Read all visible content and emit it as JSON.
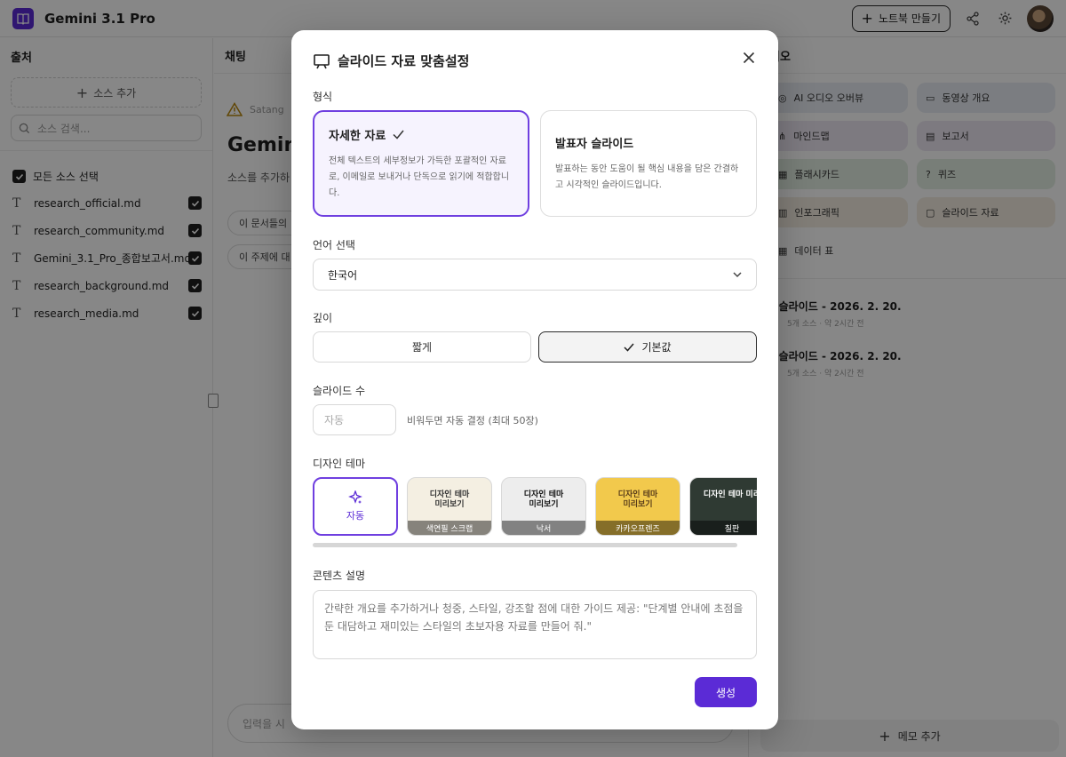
{
  "app": {
    "title": "Gemini 3.1 Pro"
  },
  "topbar": {
    "new_notebook_label": "노트북 만들기"
  },
  "sources": {
    "header": "출처",
    "add_label": "소스 추가",
    "search_placeholder": "소스 검색...",
    "select_all_label": "모든 소스 선택",
    "items": [
      {
        "name": "research_official.md"
      },
      {
        "name": "research_community.md"
      },
      {
        "name": "Gemini_3.1_Pro_종합보고서.md"
      },
      {
        "name": "research_background.md"
      },
      {
        "name": "research_media.md"
      }
    ]
  },
  "chat": {
    "header": "채팅",
    "warning_text": "Satang",
    "title": "Gemini",
    "subtitle": "소스를 추가하",
    "chips": [
      "이 문서들의",
      "이 주제에 대"
    ],
    "input_placeholder": "입력을 시"
  },
  "studio": {
    "header": "디오",
    "tiles": [
      {
        "label": "AI 오디오 오버뷰",
        "icon": "audio-icon",
        "color": "#e8ecf3"
      },
      {
        "label": "동영상 개요",
        "icon": "video-icon",
        "color": "#e8ecf3"
      },
      {
        "label": "마인드맵",
        "icon": "mindmap-icon",
        "color": "#ece6f2"
      },
      {
        "label": "보고서",
        "icon": "report-icon",
        "color": "#ece6f2"
      },
      {
        "label": "플래시카드",
        "icon": "flashcard-icon",
        "color": "#e3eee2"
      },
      {
        "label": "퀴즈",
        "icon": "quiz-icon",
        "color": "#e3eee2"
      },
      {
        "label": "인포그래픽",
        "icon": "infographic-icon",
        "color": "#f3ede0"
      },
      {
        "label": "슬라이드 자료",
        "icon": "slides-icon",
        "color": "#f3ede0"
      },
      {
        "label": "데이터 표",
        "icon": "table-icon",
        "color": "#ffffff"
      }
    ],
    "items": [
      {
        "title": "슬라이드 - 2026. 2. 20.",
        "meta": "5개 소스 · 약 2시간 전"
      },
      {
        "title": "슬라이드 - 2026. 2. 20.",
        "meta": "5개 소스 · 약 2시간 전"
      }
    ],
    "add_memo_label": "메모 추가"
  },
  "modal": {
    "title": "슬라이드 자료 맞춤설정",
    "format_label": "형식",
    "formats": [
      {
        "title": "자세한 자료",
        "desc": "전체 텍스트의 세부정보가 가득한 포괄적인 자료로, 이메일로 보내거나 단독으로 읽기에 적합합니다.",
        "selected": true
      },
      {
        "title": "발표자 슬라이드",
        "desc": "발표하는 동안 도움이 될 핵심 내용을 담은 간결하고 시각적인 슬라이드입니다.",
        "selected": false
      }
    ],
    "language_label": "언어 선택",
    "language_value": "한국어",
    "depth_label": "깊이",
    "depth_options": [
      "짧게",
      "기본값"
    ],
    "depth_selected": "기본값",
    "slide_count_label": "슬라이드 수",
    "slide_count_placeholder": "자동",
    "slide_count_hint": "비워두면 자동 결정 (최대 50장)",
    "theme_label": "디자인 테마",
    "themes": [
      {
        "name": "자동",
        "selected": true
      },
      {
        "name": "색연필 스크랩",
        "preview": "디자인 테마\n미리보기",
        "bg": "#f4efe2",
        "fg": "#333333"
      },
      {
        "name": "낙서",
        "preview": "디자인 테마\n미리보기",
        "bg": "#ededed",
        "fg": "#111111"
      },
      {
        "name": "카카오프렌즈",
        "preview": "디자인 테마\n미리보기",
        "bg": "#f2c94c",
        "fg": "#5a3e1b"
      },
      {
        "name": "칠판",
        "preview": "디자인 테마 미리",
        "bg": "#2f3a33",
        "fg": "#ffffff"
      }
    ],
    "content_label": "콘텐츠 설명",
    "content_placeholder": "간략한 개요를 추가하거나 청중, 스타일, 강조할 점에 대한 가이드 제공: \"단계별 안내에 초점을 둔 대담하고 재미있는 스타일의 초보자용 자료를 만들어 줘.\"",
    "generate_label": "생성",
    "accent_color": "#5b2bd6"
  }
}
